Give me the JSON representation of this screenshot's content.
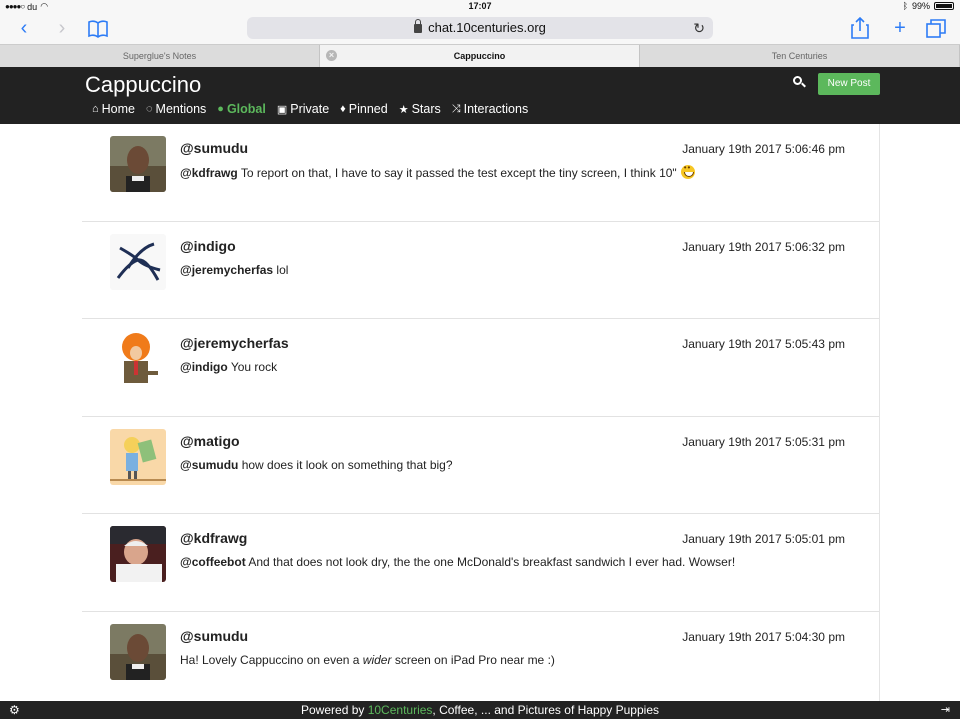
{
  "status_bar": {
    "carrier": "du",
    "time": "17:07",
    "battery": "99%"
  },
  "browser": {
    "url": "chat.10centuries.org",
    "tabs": [
      {
        "label": "Superglue's Notes"
      },
      {
        "label": "Cappuccino"
      },
      {
        "label": "Ten Centuries"
      }
    ]
  },
  "app": {
    "brand": "Cappuccino",
    "new_post_label": "New Post",
    "nav": [
      {
        "label": "Home",
        "icon": "home-icon"
      },
      {
        "label": "Mentions",
        "icon": "speech-bubbles-icon"
      },
      {
        "label": "Global",
        "icon": "globe-icon"
      },
      {
        "label": "Private",
        "icon": "lock-icon"
      },
      {
        "label": "Pinned",
        "icon": "pin-icon"
      },
      {
        "label": "Stars",
        "icon": "star-icon"
      },
      {
        "label": "Interactions",
        "icon": "shuffle-icon"
      }
    ],
    "active_nav": "Global"
  },
  "posts": [
    {
      "user": "@sumudu",
      "time": "January 19th 2017 5:06:46 pm",
      "mention": "@kdfrawg",
      "text": " To report on that, I have to say it passed the test except the tiny screen, I think 10\""
    },
    {
      "user": "@indigo",
      "time": "January 19th 2017 5:06:32 pm",
      "mention": "@jeremycherfas",
      "text": " lol"
    },
    {
      "user": "@jeremycherfas",
      "time": "January 19th 2017 5:05:43 pm",
      "mention": "@indigo",
      "text": " You rock"
    },
    {
      "user": "@matigo",
      "time": "January 19th 2017 5:05:31 pm",
      "mention": "@sumudu",
      "text": " how does it look on something that big?"
    },
    {
      "user": "@kdfrawg",
      "time": "January 19th 2017 5:05:01 pm",
      "mention": "@coffeebot",
      "text": " And that does not look dry, the the one McDonald's breakfast sandwich I ever had. Wowser!"
    },
    {
      "user": "@sumudu",
      "time": "January 19th 2017 5:04:30 pm",
      "text_before": "Ha! Lovely Cappuccino on even a ",
      "text_em": "wider",
      "text_after": " screen on iPad Pro near me :)"
    }
  ],
  "footer": {
    "prefix": "Powered by ",
    "link": "10Centuries",
    "suffix": ", Coffee, ... and Pictures of Happy Puppies"
  },
  "colors": {
    "accent": "#5cb85c",
    "header_bg": "#222222",
    "ios_blue": "#2d7cf6"
  }
}
